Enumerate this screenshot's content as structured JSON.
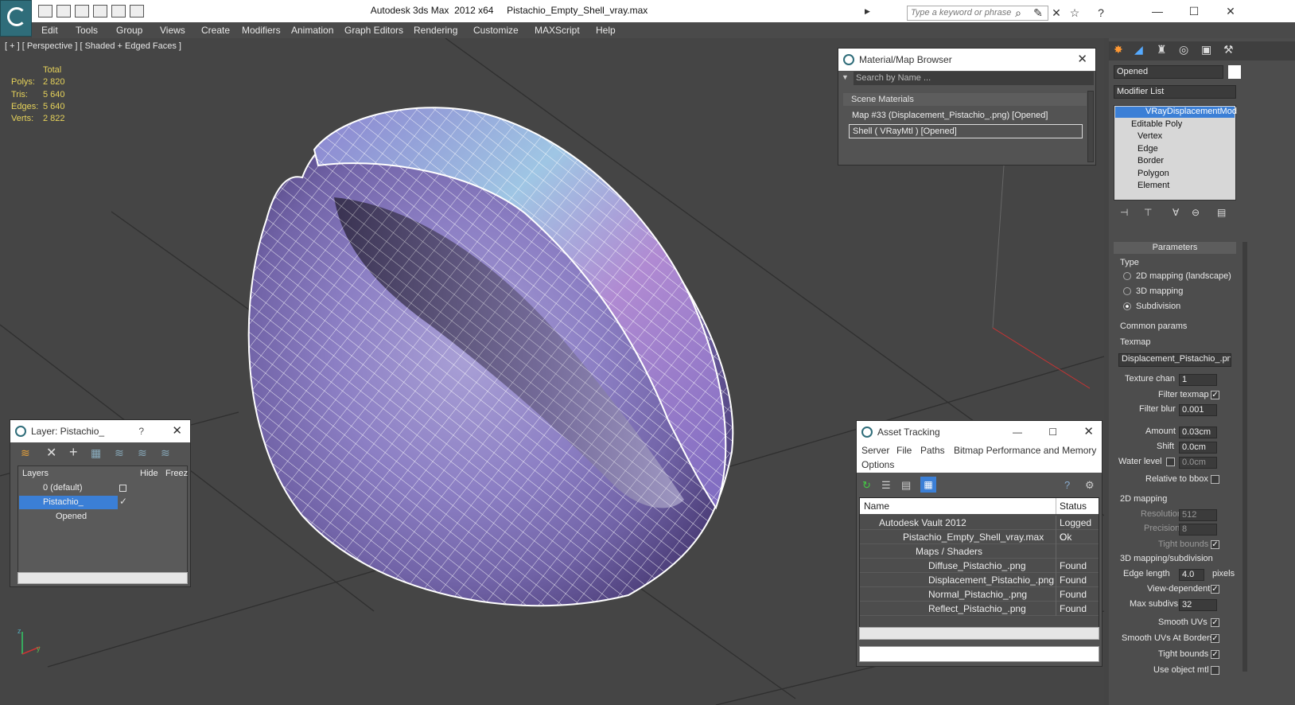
{
  "window": {
    "title": "Autodesk 3ds Max  2012 x64     Pistachio_Empty_Shell_vray.max",
    "search_placeholder": "Type a keyword or phrase",
    "minimize": "—",
    "maximize": "☐",
    "close": "✕"
  },
  "menu": [
    "Edit",
    "Tools",
    "Group",
    "Views",
    "Create",
    "Modifiers",
    "Animation",
    "Graph Editors",
    "Rendering",
    "Customize",
    "MAXScript",
    "Help"
  ],
  "viewport": {
    "label": "[ + ] [ Perspective ] [ Shaded + Edged Faces ]",
    "stats_header": "Total",
    "stats": [
      {
        "label": "Polys:",
        "value": "2 820"
      },
      {
        "label": "Tris:",
        "value": "5 640"
      },
      {
        "label": "Edges:",
        "value": "5 640"
      },
      {
        "label": "Verts:",
        "value": "2 822"
      }
    ]
  },
  "material_browser": {
    "title": "Material/Map Browser",
    "search_placeholder": "Search by Name ...",
    "group": "Scene Materials",
    "group_toggle": "-",
    "items": [
      "Map #33 (Displacement_Pistachio_.png) [Opened]",
      "Shell  ( VRayMtl ) [Opened]"
    ]
  },
  "layer_window": {
    "title": "Layer: Pistachio_",
    "help": "?",
    "headers": {
      "layers": "Layers",
      "hide": "Hide",
      "freeze": "Freeze"
    },
    "rows": [
      "0 (default)",
      "Pistachio_",
      "Opened"
    ]
  },
  "asset_tracking": {
    "title": "Asset Tracking",
    "menu": [
      "Server",
      "File",
      "Paths",
      "Bitmap Performance and Memory",
      "Options"
    ],
    "headers": {
      "name": "Name",
      "status": "Status"
    },
    "rows": [
      {
        "name": "Autodesk Vault 2012",
        "status": "Logged O"
      },
      {
        "name": "Pistachio_Empty_Shell_vray.max",
        "status": "Ok"
      },
      {
        "name": "Maps / Shaders",
        "status": ""
      },
      {
        "name": "Diffuse_Pistachio_.png",
        "status": "Found"
      },
      {
        "name": "Displacement_Pistachio_.png",
        "status": "Found"
      },
      {
        "name": "Normal_Pistachio_.png",
        "status": "Found"
      },
      {
        "name": "Reflect_Pistachio_.png",
        "status": "Found"
      }
    ]
  },
  "command_panel": {
    "object_name": "Opened",
    "modifier_list": "Modifier List",
    "stack": [
      "VRayDisplacementMod",
      "Editable Poly",
      "Vertex",
      "Edge",
      "Border",
      "Polygon",
      "Element"
    ],
    "parameters_title": "Parameters",
    "type_label": "Type",
    "type_options": [
      "2D mapping (landscape)",
      "3D mapping",
      "Subdivision"
    ],
    "common_params": "Common params",
    "texmap_label": "Texmap",
    "texmap_value": "Displacement_Pistachio_.png)",
    "texture_chan_label": "Texture chan",
    "texture_chan": "1",
    "filter_texmap": "Filter texmap",
    "filter_blur_label": "Filter blur",
    "filter_blur": "0.001",
    "amount_label": "Amount",
    "amount": "0.03cm",
    "shift_label": "Shift",
    "shift": "0.0cm",
    "water_level_label": "Water level",
    "water_level": "0.0cm",
    "relative_bbox": "Relative to bbox",
    "mapping_2d": "2D mapping",
    "resolution_label": "Resolution",
    "resolution": "512",
    "precision_label": "Precision",
    "precision": "8",
    "tight_bounds": "Tight bounds",
    "mapping_3d": "3D mapping/subdivision",
    "edge_length_label": "Edge length",
    "edge_length": "4.0",
    "pixels": "pixels",
    "view_dependent": "View-dependent",
    "max_subdivs_label": "Max subdivs",
    "max_subdivs": "32",
    "smooth_uvs": "Smooth UVs",
    "smooth_uvs_borders": "Smooth UVs At Borders",
    "tight_bounds2": "Tight bounds",
    "use_object_mtl": "Use object mtl"
  },
  "colors": {
    "accent": "#2f6d7a",
    "selection": "#3b7fd6",
    "stats": "#e6d25a"
  }
}
